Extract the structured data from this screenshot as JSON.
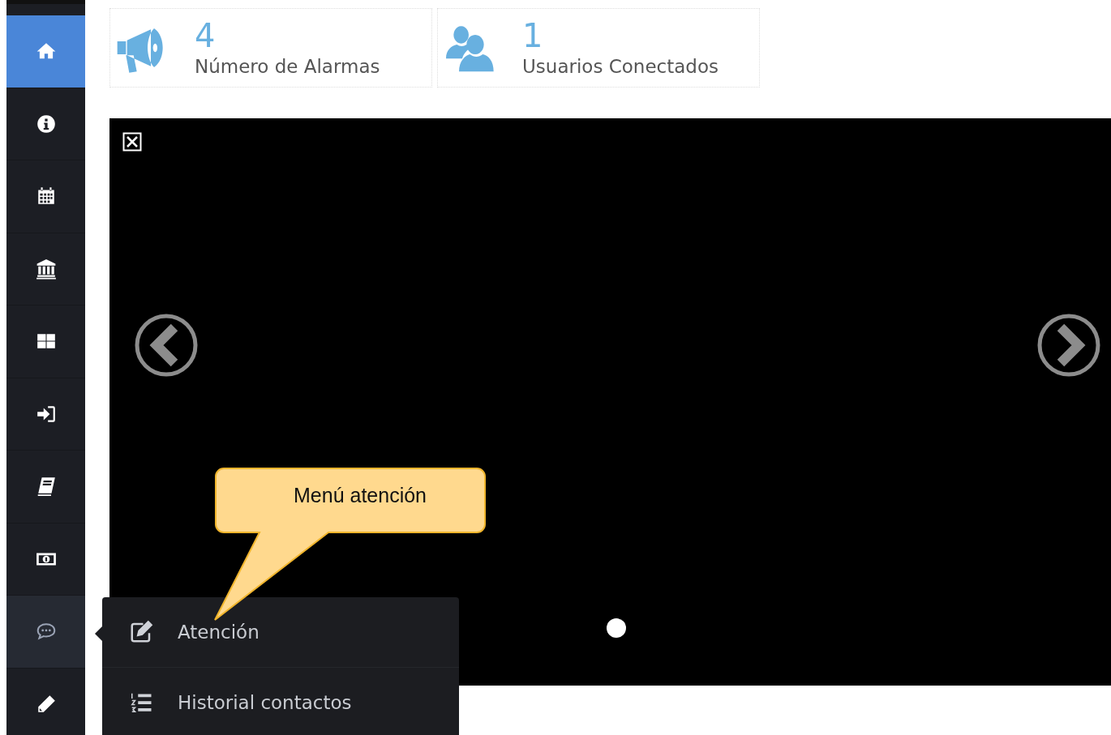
{
  "sidebar": {
    "items": [
      {
        "selected": true,
        "expanded": false
      },
      {
        "selected": false,
        "expanded": false
      },
      {
        "selected": false,
        "expanded": false
      },
      {
        "selected": false,
        "expanded": false
      },
      {
        "selected": false,
        "expanded": false
      },
      {
        "selected": false,
        "expanded": false
      },
      {
        "selected": false,
        "expanded": false
      },
      {
        "selected": false,
        "expanded": false
      },
      {
        "selected": false,
        "expanded": true
      },
      {
        "selected": false,
        "expanded": false
      }
    ]
  },
  "stats": [
    {
      "value": "4",
      "label": "Número de Alarmas"
    },
    {
      "value": "1",
      "label": "Usuarios Conectados"
    }
  ],
  "slider": {
    "dots": [
      {
        "selected": true
      }
    ]
  },
  "submenu": {
    "items": [
      {
        "label": "Atención"
      },
      {
        "label": "Historial contactos"
      }
    ]
  },
  "callout": {
    "text": "Menú atención"
  }
}
